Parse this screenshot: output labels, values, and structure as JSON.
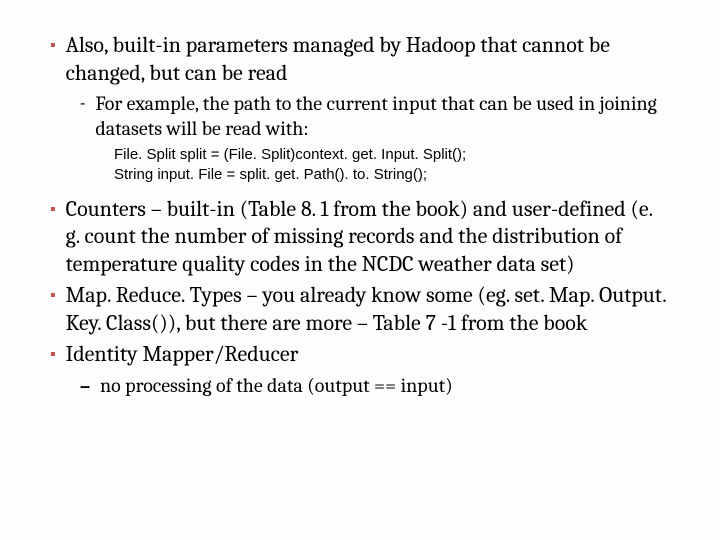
{
  "bullets": {
    "b1": "Also, built-in parameters managed by Hadoop that cannot be changed, but can be read",
    "b1_sub": "For example, the path to the current input that can be used in joining datasets will be read with:",
    "code_line1": "File. Split split = (File. Split)context. get. Input. Split();",
    "code_line2": "String input. File = split. get. Path(). to. String();",
    "b2": "Counters – built-in (Table 8. 1 from the book) and user-defined (e. g. count the number of missing records and the distribution of temperature quality codes in the NCDC weather data set)",
    "b3": "Map. Reduce. Types – you already know some (eg. set. Map. Output. Key. Class()), but there are more – Table 7 -1 from the book",
    "b4": "Identity Mapper/Reducer",
    "b4_sub": "no processing of the data (output == input)"
  },
  "markers": {
    "square": "▪",
    "hyphen": "-",
    "endash": "–"
  }
}
